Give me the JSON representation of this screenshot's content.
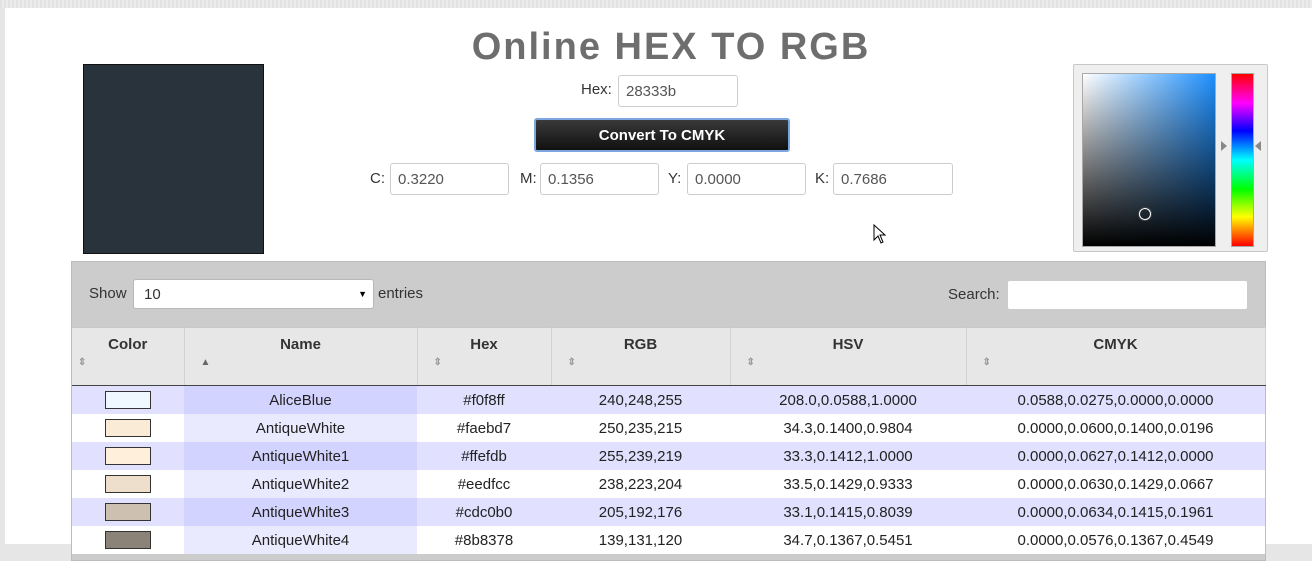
{
  "title": "Online HEX TO RGB",
  "swatch_color": "#28333b",
  "hex": {
    "label": "Hex:",
    "value": "28333b"
  },
  "convert_button": "Convert To CMYK",
  "cmyk": [
    {
      "label": "C:",
      "value": "0.3220"
    },
    {
      "label": "M:",
      "value": "0.1356"
    },
    {
      "label": "Y:",
      "value": "0.0000"
    },
    {
      "label": "K:",
      "value": "0.7686"
    }
  ],
  "table_controls": {
    "show_label": "Show",
    "entries_value": "10",
    "entries_label": "entries",
    "search_label": "Search:",
    "search_value": ""
  },
  "columns": [
    "Color",
    "Name",
    "Hex",
    "RGB",
    "HSV",
    "CMYK"
  ],
  "rows": [
    {
      "color": "#f0f8ff",
      "name": "AliceBlue",
      "hex": "#f0f8ff",
      "rgb": "240,248,255",
      "hsv": "208.0,0.0588,1.0000",
      "cmyk": "0.0588,0.0275,0.0000,0.0000"
    },
    {
      "color": "#faebd7",
      "name": "AntiqueWhite",
      "hex": "#faebd7",
      "rgb": "250,235,215",
      "hsv": "34.3,0.1400,0.9804",
      "cmyk": "0.0000,0.0600,0.1400,0.0196"
    },
    {
      "color": "#ffefdb",
      "name": "AntiqueWhite1",
      "hex": "#ffefdb",
      "rgb": "255,239,219",
      "hsv": "33.3,0.1412,1.0000",
      "cmyk": "0.0000,0.0627,0.1412,0.0000"
    },
    {
      "color": "#eedfcc",
      "name": "AntiqueWhite2",
      "hex": "#eedfcc",
      "rgb": "238,223,204",
      "hsv": "33.5,0.1429,0.9333",
      "cmyk": "0.0000,0.0630,0.1429,0.0667"
    },
    {
      "color": "#cdc0b0",
      "name": "AntiqueWhite3",
      "hex": "#cdc0b0",
      "rgb": "205,192,176",
      "hsv": "33.1,0.1415,0.8039",
      "cmyk": "0.0000,0.0634,0.1415,0.1961"
    },
    {
      "color": "#8b8378",
      "name": "AntiqueWhite4",
      "hex": "#8b8378",
      "rgb": "139,131,120",
      "hsv": "34.7,0.1367,0.5451",
      "cmyk": "0.0000,0.0576,0.1367,0.4549"
    }
  ]
}
